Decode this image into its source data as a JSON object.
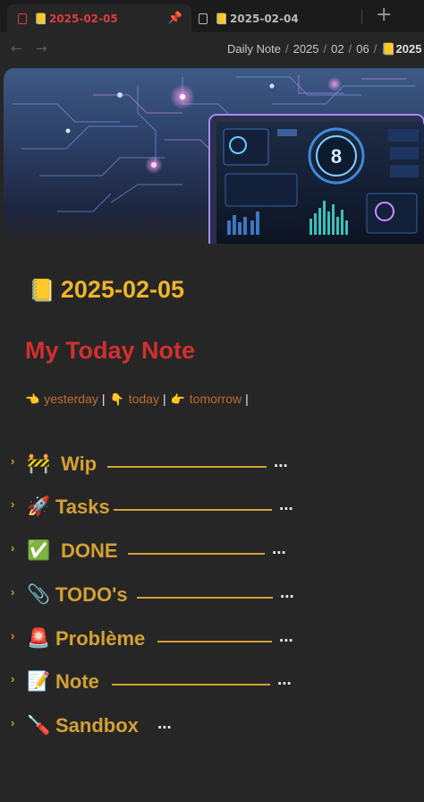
{
  "tabs": [
    {
      "icon": "📒",
      "label": "2025-02-05",
      "active": true
    },
    {
      "icon": "📒",
      "label": "2025-02-04",
      "active": false
    }
  ],
  "new_tab_label": "+",
  "breadcrumb": [
    "Daily Note",
    "2025",
    "02",
    "06"
  ],
  "breadcrumb_last": {
    "icon": "📒",
    "label": "2025"
  },
  "banner": {
    "center_badge": "8"
  },
  "note": {
    "icon": "📒",
    "title": "2025-02-05",
    "heading": "My Today Note"
  },
  "day_nav": {
    "yesterday": {
      "icon": "👈",
      "label": "yesterday"
    },
    "today": {
      "icon": "👇",
      "label": "today"
    },
    "tomorrow": {
      "icon": "👉",
      "label": "tomorrow"
    },
    "separator": "|"
  },
  "sections": [
    {
      "emoji": "🚧",
      "label": "Wip"
    },
    {
      "emoji": "🚀",
      "label": "Tasks"
    },
    {
      "emoji": "✅",
      "label": "DONE"
    },
    {
      "emoji": "📎",
      "label": "TODO's"
    },
    {
      "emoji": "🚨",
      "label": "Problème"
    },
    {
      "emoji": "📝",
      "label": "Note"
    },
    {
      "emoji": "🪛",
      "label": "Sandbox"
    }
  ],
  "ellipsis": "...",
  "colors": {
    "background": "#262626",
    "accent_yellow": "#f0b429",
    "heading_red": "#d32f2f",
    "section_gold": "#d4a035",
    "link_orange": "#c26a2c"
  }
}
